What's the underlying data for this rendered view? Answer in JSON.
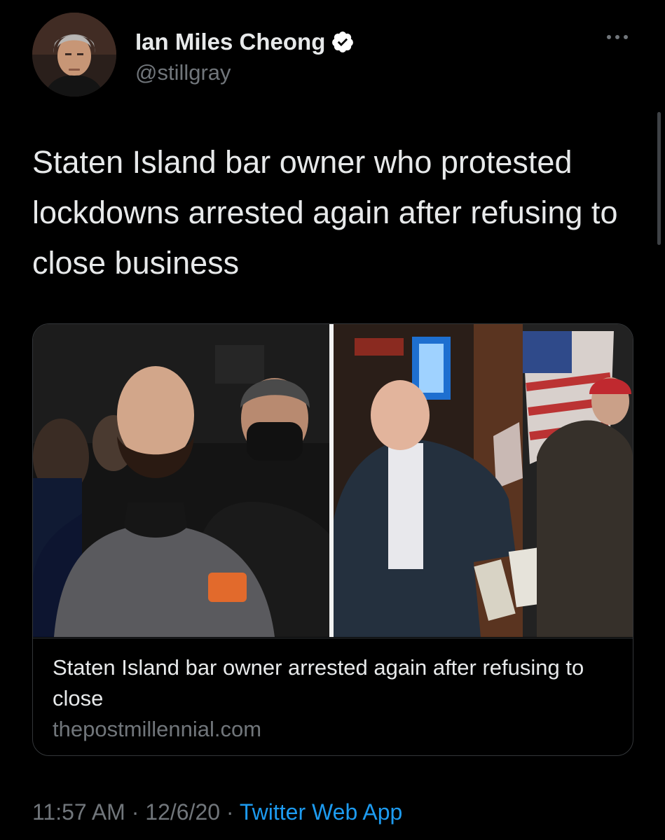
{
  "tweet": {
    "author": {
      "display_name": "Ian Miles Cheong",
      "handle": "@stillgray",
      "verified": true
    },
    "text": "Staten Island bar owner who protested lockdowns arrested again after refusing to close business",
    "card": {
      "title": "Staten Island bar owner arrested again after refusing to close",
      "domain": "thepostmillennial.com",
      "images": [
        "bar-owner-arrest-photo",
        "bar-owner-exiting-bar-photo"
      ]
    },
    "meta": {
      "time": "11:57 AM",
      "separator": "·",
      "date": "12/6/20",
      "source": "Twitter Web App"
    }
  },
  "icons": {
    "verified": "verified-badge-icon",
    "more": "more-options-icon"
  },
  "colors": {
    "background": "#000000",
    "text_primary": "#e7e9ea",
    "text_secondary": "#71767b",
    "link": "#1d9bf0",
    "border": "#333639"
  }
}
